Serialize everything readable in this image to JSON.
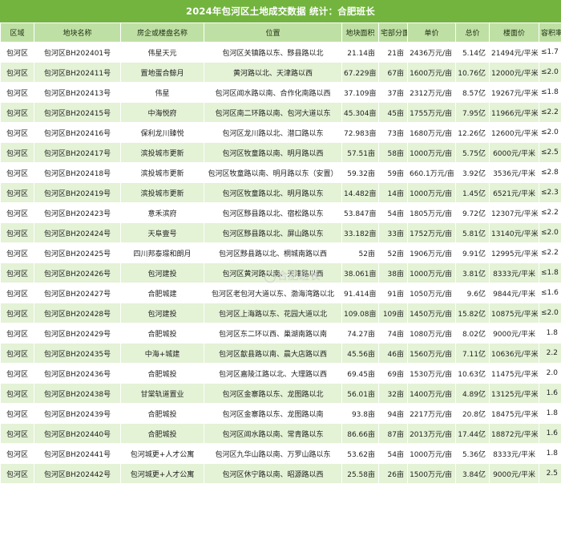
{
  "title": "2024年包河区土地成交数据  统计：合肥班长",
  "watermark": "合肥班长",
  "columns": [
    "区域",
    "地块名称",
    "房企或楼盘名称",
    "位置",
    "地块面积",
    "宅部分面",
    "单价",
    "总价",
    "楼面价",
    "容积率"
  ],
  "rows": [
    [
      "包河区",
      "包河区BH202401号",
      "伟星天元",
      "包河区关镇路以东、黟县路以北",
      "21.14亩",
      "21亩",
      "2436万元/亩",
      "5.14亿",
      "21494元/平米",
      "≤1.7"
    ],
    [
      "包河区",
      "包河区BH202411号",
      "置地蛋合鲸月",
      "黄河路以北、天津路以西",
      "67.229亩",
      "67亩",
      "1600万元/亩",
      "10.76亿",
      "12000元/平米",
      "≤2.0"
    ],
    [
      "包河区",
      "包河区BH202413号",
      "伟星",
      "包河区阊水路以南、合作化南路以西",
      "37.109亩",
      "37亩",
      "2312万元/亩",
      "8.57亿",
      "19267元/平米",
      "≤1.8"
    ],
    [
      "包河区",
      "包河区BH202415号",
      "中海悦府",
      "包河区南二环路以南、包河大道以东",
      "45.304亩",
      "45亩",
      "1755万元/亩",
      "7.95亿",
      "11966元/平米",
      "≤2.2"
    ],
    [
      "包河区",
      "包河区BH202416号",
      "保利龙川臻悦",
      "包河区龙川路以北、潜口路以东",
      "72.983亩",
      "73亩",
      "1680万元/亩",
      "12.26亿",
      "12600元/平米",
      "≤2.0"
    ],
    [
      "包河区",
      "包河区BH202417号",
      "滨投城市更新",
      "包河区牧童路以南、明月路以西",
      "57.51亩",
      "58亩",
      "1000万元/亩",
      "5.75亿",
      "6000元/平米",
      "≤2.5"
    ],
    [
      "包河区",
      "包河区BH202418号",
      "滨投城市更新",
      "包河区牧童路以南、明月路以东（安置）",
      "59.32亩",
      "59亩",
      "660.1万元/亩",
      "3.92亿",
      "3536元/平米",
      "≤2.8"
    ],
    [
      "包河区",
      "包河区BH202419号",
      "滨投城市更新",
      "包河区牧童路以北、明月路以东",
      "14.482亩",
      "14亩",
      "1000万元/亩",
      "1.45亿",
      "6521元/平米",
      "≤2.3"
    ],
    [
      "包河区",
      "包河区BH202423号",
      "意禾滨府",
      "包河区黟县路以北、宿松路以东",
      "53.847亩",
      "54亩",
      "1805万元/亩",
      "9.72亿",
      "12307元/平米",
      "≤2.2"
    ],
    [
      "包河区",
      "包河区BH202424号",
      "天阜壹号",
      "包河区黟县路以北、屏山路以东",
      "33.182亩",
      "33亩",
      "1752万元/亩",
      "5.81亿",
      "13140元/平米",
      "≤2.0"
    ],
    [
      "包河区",
      "包河区BH202425号",
      "四川邦泰璟和朗月",
      "包河区黟县路以北、桐城南路以西",
      "52亩",
      "52亩",
      "1906万元/亩",
      "9.91亿",
      "12995元/平米",
      "≤2.2"
    ],
    [
      "包河区",
      "包河区BH202426号",
      "包河建投",
      "包河区黄河路以南、天津路以西",
      "38.061亩",
      "38亩",
      "1000万元/亩",
      "3.81亿",
      "8333元/平米",
      "≤1.8"
    ],
    [
      "包河区",
      "包河区BH202427号",
      "合肥城建",
      "包河区老包河大道以东、渤海湾路以北",
      "91.414亩",
      "91亩",
      "1050万元/亩",
      "9.6亿",
      "9844元/平米",
      "≤1.6"
    ],
    [
      "包河区",
      "包河区BH202428号",
      "包河建投",
      "包河区上海路以东、花园大道以北",
      "109.08亩",
      "109亩",
      "1450万元/亩",
      "15.82亿",
      "10875元/平米",
      "≤2.0"
    ],
    [
      "包河区",
      "包河区BH202429号",
      "合肥城投",
      "包河区东二环以西、巢湖南路以南",
      "74.27亩",
      "74亩",
      "1080万元/亩",
      "8.02亿",
      "9000元/平米",
      "1.8"
    ],
    [
      "包河区",
      "包河区BH202435号",
      "中海+城建",
      "包河区歙县路以南、晨大店路以西",
      "45.56亩",
      "46亩",
      "1560万元/亩",
      "7.11亿",
      "10636元/平米",
      "2.2"
    ],
    [
      "包河区",
      "包河区BH202436号",
      "合肥城投",
      "包河区嘉陵江路以北、大理路以西",
      "69.45亩",
      "69亩",
      "1530万元/亩",
      "10.63亿",
      "11475元/平米",
      "2.0"
    ],
    [
      "包河区",
      "包河区BH202438号",
      "甘棠轨道置业",
      "包河区金寨路以东、龙图路以北",
      "56.01亩",
      "32亩",
      "1400万元/亩",
      "4.89亿",
      "13125元/平米",
      "1.6"
    ],
    [
      "包河区",
      "包河区BH202439号",
      "合肥城投",
      "包河区金寨路以东、龙图路以南",
      "93.8亩",
      "94亩",
      "2217万元/亩",
      "20.8亿",
      "18475元/平米",
      "1.8"
    ],
    [
      "包河区",
      "包河区BH202440号",
      "合肥城投",
      "包河区阊水路以南、常青路以东",
      "86.66亩",
      "87亩",
      "2013万元/亩",
      "17.44亿",
      "18872元/平米",
      "1.6"
    ],
    [
      "包河区",
      "包河区BH202441号",
      "包河城更+人才公寓",
      "包河区九华山路以南、万罗山路以东",
      "53.62亩",
      "54亩",
      "1000万元/亩",
      "5.36亿",
      "8333元/平米",
      "1.8"
    ],
    [
      "包河区",
      "包河区BH202442号",
      "包河城更+人才公寓",
      "包河区休宁路以南、昭源路以西",
      "25.58亩",
      "26亩",
      "1500万元/亩",
      "3.84亿",
      "9000元/平米",
      "2.5"
    ]
  ]
}
